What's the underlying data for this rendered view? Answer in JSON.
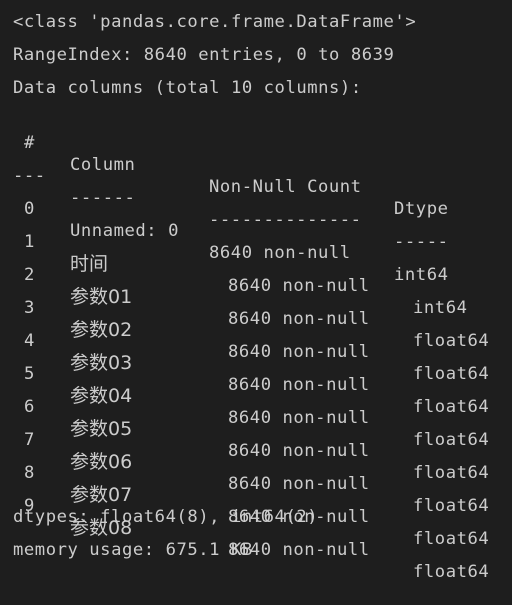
{
  "header": {
    "class_line": "<class 'pandas.core.frame.DataFrame'>",
    "range_index": "RangeIndex: 8640 entries, 0 to 8639",
    "data_columns": "Data columns (total 10 columns):"
  },
  "table": {
    "headers": {
      "index": "#",
      "column": "Column",
      "count": "Non-Null Count",
      "dtype": "Dtype"
    },
    "separators": {
      "index": "---",
      "column": "------",
      "count": "--------------",
      "dtype": "-----"
    },
    "rows": [
      {
        "index": "0",
        "column": "Unnamed: 0",
        "count": "8640 non-null",
        "dtype": "int64"
      },
      {
        "index": "1",
        "column": "时间",
        "count": "8640 non-null",
        "dtype": "int64"
      },
      {
        "index": "2",
        "column": "参数01",
        "count": "8640 non-null",
        "dtype": "float64"
      },
      {
        "index": "3",
        "column": "参数02",
        "count": "8640 non-null",
        "dtype": "float64"
      },
      {
        "index": "4",
        "column": "参数03",
        "count": "8640 non-null",
        "dtype": "float64"
      },
      {
        "index": "5",
        "column": "参数04",
        "count": "8640 non-null",
        "dtype": "float64"
      },
      {
        "index": "6",
        "column": "参数05",
        "count": "8640 non-null",
        "dtype": "float64"
      },
      {
        "index": "7",
        "column": "参数06",
        "count": "8640 non-null",
        "dtype": "float64"
      },
      {
        "index": "8",
        "column": "参数07",
        "count": "8640 non-null",
        "dtype": "float64"
      },
      {
        "index": "9",
        "column": "参数08",
        "count": "8640 non-null",
        "dtype": "float64"
      }
    ]
  },
  "footer": {
    "dtypes": "dtypes: float64(8), int64(2)",
    "memory": "memory usage: 675.1 KB"
  },
  "colors": {
    "background": "#1e1e1e",
    "text": "#cccccc"
  }
}
